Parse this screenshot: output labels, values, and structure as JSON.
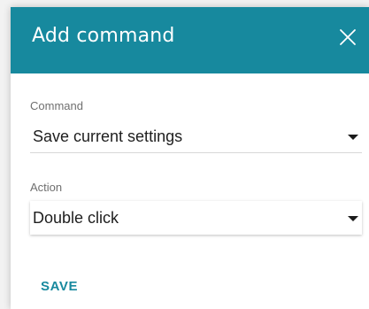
{
  "dialog": {
    "title": "Add command",
    "close_icon": "close-icon"
  },
  "fields": {
    "command": {
      "label": "Command",
      "value": "Save current settings"
    },
    "action": {
      "label": "Action",
      "value": "Double click"
    }
  },
  "actions": {
    "save_label": "SAVE"
  },
  "colors": {
    "header": "#17899e",
    "accent": "#17899e"
  }
}
